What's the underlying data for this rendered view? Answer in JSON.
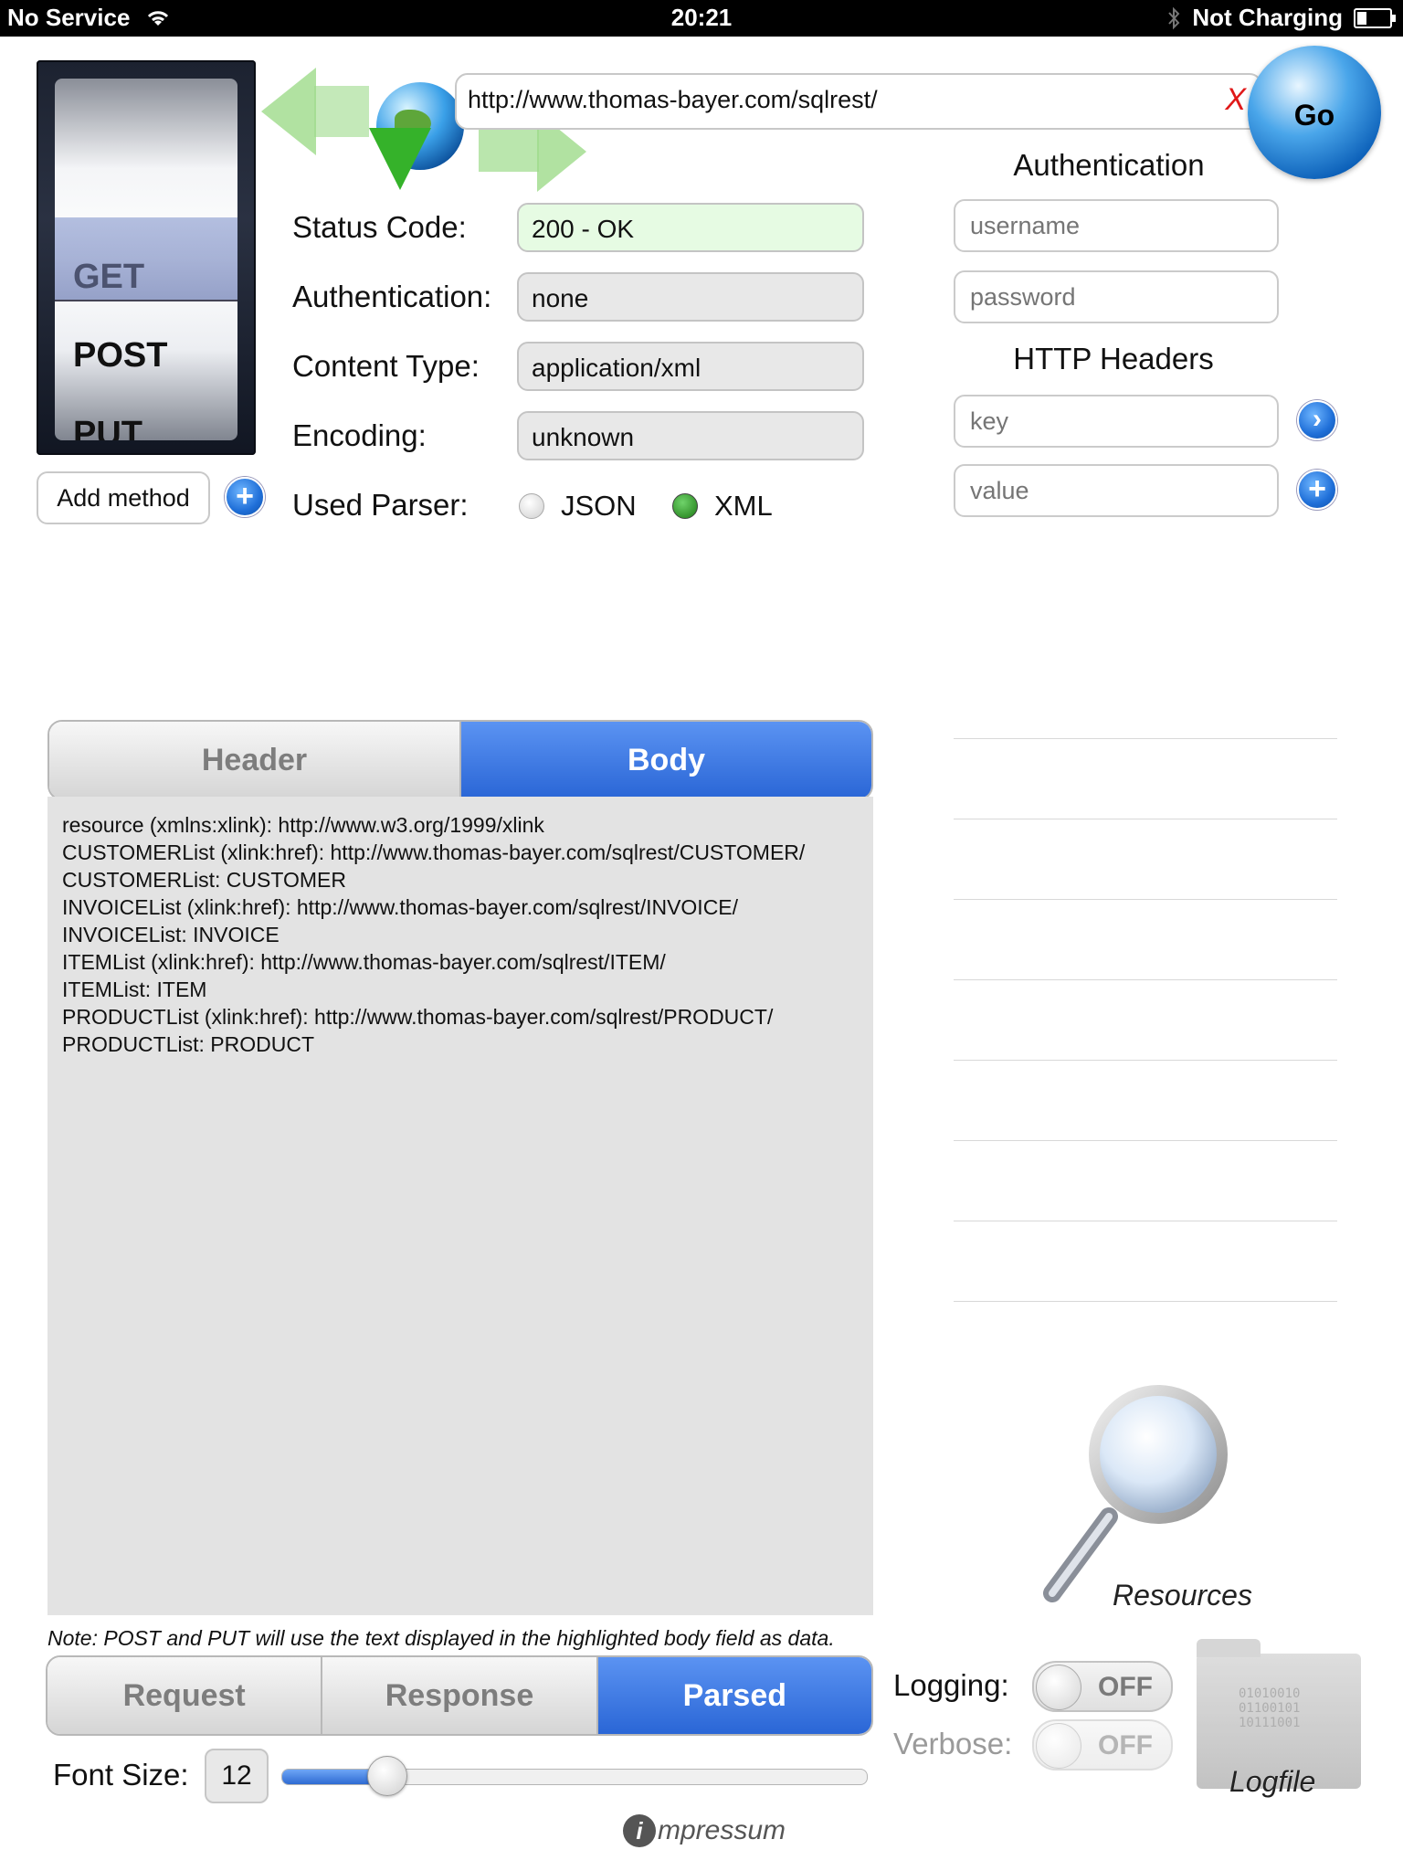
{
  "status_bar": {
    "carrier": "No Service",
    "time": "20:21",
    "charging": "Not Charging"
  },
  "method_picker": {
    "items": [
      "GET",
      "POST",
      "PUT"
    ],
    "selected": "GET",
    "add_method_label": "Add method"
  },
  "url_bar": {
    "value": "http://www.thomas-bayer.com/sqlrest/",
    "clear_label": "X",
    "go_label": "Go"
  },
  "info": {
    "status_code_label": "Status Code:",
    "status_code_value": "200 - OK",
    "authentication_label": "Authentication:",
    "authentication_value": "none",
    "content_type_label": "Content Type:",
    "content_type_value": "application/xml",
    "encoding_label": "Encoding:",
    "encoding_value": "unknown",
    "parser_label": "Used Parser:",
    "parser_options": [
      "JSON",
      "XML"
    ],
    "parser_selected": "XML"
  },
  "auth_panel": {
    "title": "Authentication",
    "username_placeholder": "username",
    "password_placeholder": "password"
  },
  "headers_panel": {
    "title": "HTTP Headers",
    "key_placeholder": "key",
    "value_placeholder": "value"
  },
  "tabs_top": {
    "items": [
      "Header",
      "Body"
    ],
    "active": "Body"
  },
  "body_lines": [
    "resource (xmlns:xlink): http://www.w3.org/1999/xlink",
    "CUSTOMERList (xlink:href): http://www.thomas-bayer.com/sqlrest/CUSTOMER/",
    "CUSTOMERList: CUSTOMER",
    "INVOICEList (xlink:href): http://www.thomas-bayer.com/sqlrest/INVOICE/",
    "INVOICEList: INVOICE",
    "ITEMList (xlink:href): http://www.thomas-bayer.com/sqlrest/ITEM/",
    "ITEMList: ITEM",
    "PRODUCTList (xlink:href): http://www.thomas-bayer.com/sqlrest/PRODUCT/",
    "PRODUCTList: PRODUCT"
  ],
  "note": "Note: POST and PUT will use the text displayed in the highlighted body field as data.",
  "tabs_bottom": {
    "items": [
      "Request",
      "Response",
      "Parsed"
    ],
    "active": "Parsed"
  },
  "font_size": {
    "label": "Font Size:",
    "value": "12",
    "slider_fraction": 0.18
  },
  "impressum": "mpressum",
  "impressum_badge": "i",
  "logging": {
    "logging_label": "Logging:",
    "logging_state": "OFF",
    "verbose_label": "Verbose:",
    "verbose_state": "OFF"
  },
  "resources_label": "Resources",
  "logfile_label": "Logfile",
  "logfile_bits": [
    "01010010",
    "01100101",
    "10111001"
  ],
  "colors": {
    "accent_blue": "#2a66d6",
    "status_ok_bg": "#e6fbe3",
    "pane_bg": "#e3e3e3",
    "clear_red": "#e01818"
  },
  "icons": {
    "back_arrow": "arrow-left-icon",
    "forward_arrow": "arrow-right-icon",
    "download": "globe-download-icon",
    "go": "globe-icon",
    "add": "plus-circle-icon",
    "next": "chevron-right-circle-icon",
    "resources": "magnifier-icon",
    "logfile": "folder-icon"
  }
}
